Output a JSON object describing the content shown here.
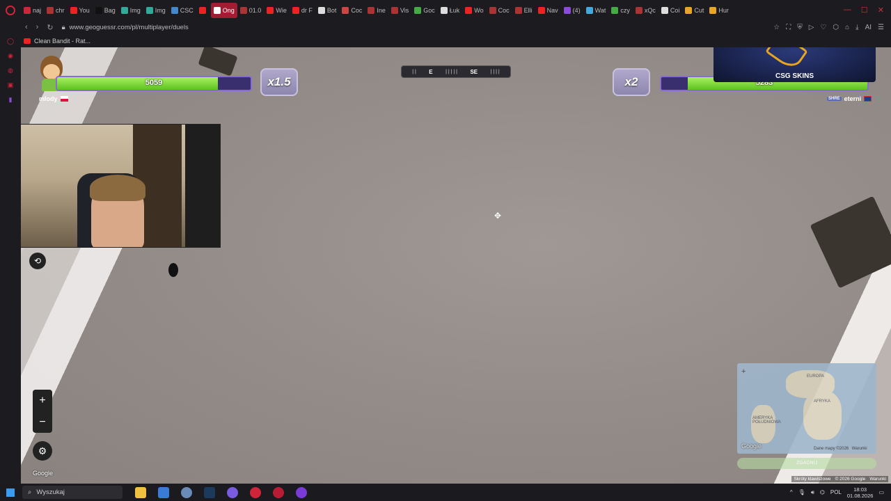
{
  "browser": {
    "tabs": [
      {
        "label": "naj",
        "color": "#d0243a"
      },
      {
        "label": "chr",
        "color": "#a33"
      },
      {
        "label": "You",
        "color": "#e22"
      },
      {
        "label": "Bag",
        "color": "#111"
      },
      {
        "label": "Img",
        "color": "#3a9"
      },
      {
        "label": "Img",
        "color": "#3a9"
      },
      {
        "label": "CSC",
        "color": "#48c"
      },
      {
        "label": "",
        "color": "#e22"
      },
      {
        "label": "Ong",
        "color": "#fff",
        "active": true
      },
      {
        "label": "01.0",
        "color": "#a33"
      },
      {
        "label": "Wie",
        "color": "#e22"
      },
      {
        "label": "dr F",
        "color": "#e22"
      },
      {
        "label": "Bot",
        "color": "#ddd"
      },
      {
        "label": "Coc",
        "color": "#c44"
      },
      {
        "label": "Ine",
        "color": "#a33"
      },
      {
        "label": "Vis",
        "color": "#a33"
      },
      {
        "label": "Goc",
        "color": "#4a4"
      },
      {
        "label": "Łuk",
        "color": "#ddd"
      },
      {
        "label": "Wo",
        "color": "#e22"
      },
      {
        "label": "Coc",
        "color": "#a33"
      },
      {
        "label": "Elli",
        "color": "#a33"
      },
      {
        "label": "Nav",
        "color": "#e22"
      },
      {
        "label": "(4)",
        "color": "#8a4bd6"
      },
      {
        "label": "Wat",
        "color": "#4ad"
      },
      {
        "label": "czy",
        "color": "#4a4"
      },
      {
        "label": "xQc",
        "color": "#a33"
      },
      {
        "label": "Coi",
        "color": "#ddd"
      },
      {
        "label": "Cut",
        "color": "#e7a521"
      },
      {
        "label": "Hur",
        "color": "#e7a521"
      }
    ],
    "url": "www.geoguessr.com/pl/multiplayer/duels",
    "bookmark": "Clean Bandit - Rat..."
  },
  "game": {
    "player1": {
      "name": "mlody",
      "score": "5059",
      "multiplier": "x1.5",
      "health": 0.83
    },
    "player2": {
      "name": "eterni",
      "tag": "SHRE",
      "score": "5283",
      "multiplier": "x2",
      "health": 0.87
    },
    "compass": {
      "left": "E",
      "right": "SE"
    },
    "ad_text": "CSG SKINS",
    "google": "Google",
    "minimap": {
      "labels": [
        "EUROPA",
        "AFRYKA",
        "AMERYKA POŁUDNIOWA"
      ],
      "credits": "Dane mapy ©2026",
      "terms": "Warunki",
      "guess_label": "ZGADNIJ"
    },
    "footer": {
      "shortcuts": "Skróty klawiszowe",
      "copyright": "© 2026 Google",
      "terms": "Warunki"
    }
  },
  "taskbar": {
    "search": "Wyszukaj",
    "lang": "POL",
    "time": "18:03",
    "date": "01.08.2026"
  }
}
